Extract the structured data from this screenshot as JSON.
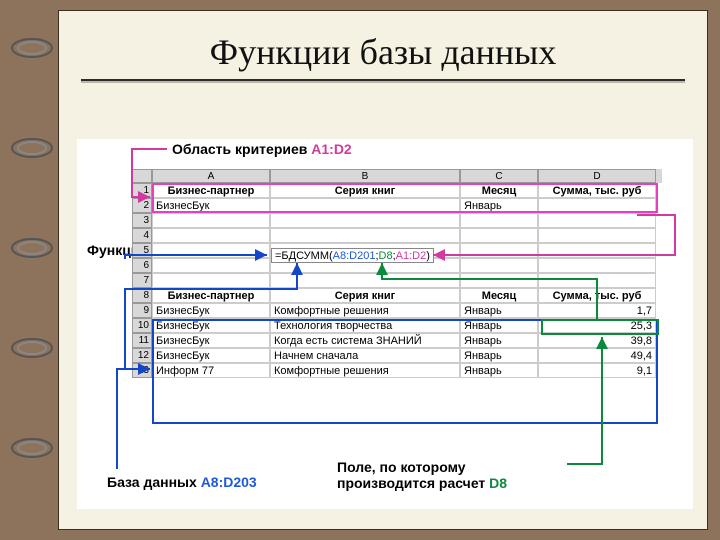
{
  "title": "Функции базы данных",
  "labels": {
    "criteria": "Область критериев",
    "criteria_range": "A1:D2",
    "function": "Функция",
    "database": "База данных",
    "database_range": "A8:D203",
    "field": "Поле, по которому производится расчет",
    "field_ref": "D8"
  },
  "columns": [
    "A",
    "B",
    "C",
    "D"
  ],
  "criteria_rows": [
    {
      "num": "1",
      "a": "Бизнес-партнер",
      "b": "Серия книг",
      "c": "Месяц",
      "d": "Сумма, тыс. руб"
    },
    {
      "num": "2",
      "a": "БизнесБук",
      "b": "",
      "c": "Январь",
      "d": ""
    },
    {
      "num": "3",
      "a": "",
      "b": "",
      "c": "",
      "d": ""
    }
  ],
  "formula_row": "5",
  "formula": {
    "prefix": "=БДСУММ(",
    "arg1": "A8:D201",
    "arg2": "D8",
    "arg3": "A1:D2",
    "suffix": ")"
  },
  "blank_rows": [
    "4",
    "6",
    "7"
  ],
  "db_header": {
    "num": "8",
    "a": "Бизнес-партнер",
    "b": "Серия книг",
    "c": "Месяц",
    "d": "Сумма, тыс. руб"
  },
  "db_rows": [
    {
      "num": "9",
      "a": "БизнесБук",
      "b": "Комфортные решения",
      "c": "Январь",
      "d": "1,7"
    },
    {
      "num": "10",
      "a": "БизнесБук",
      "b": "Технология творчества",
      "c": "Январь",
      "d": "25,3"
    },
    {
      "num": "11",
      "a": "БизнесБук",
      "b": "Когда есть система ЗНАНИЙ",
      "c": "Январь",
      "d": "39,8"
    },
    {
      "num": "12",
      "a": "БизнесБук",
      "b": "Начнем сначала",
      "c": "Январь",
      "d": "49,4"
    },
    {
      "num": "13",
      "a": "Информ 77",
      "b": "Комфортные решения",
      "c": "Январь",
      "d": "9,1"
    }
  ],
  "col_widths": {
    "a": 118,
    "b": 190,
    "c": 78,
    "d": 118
  }
}
